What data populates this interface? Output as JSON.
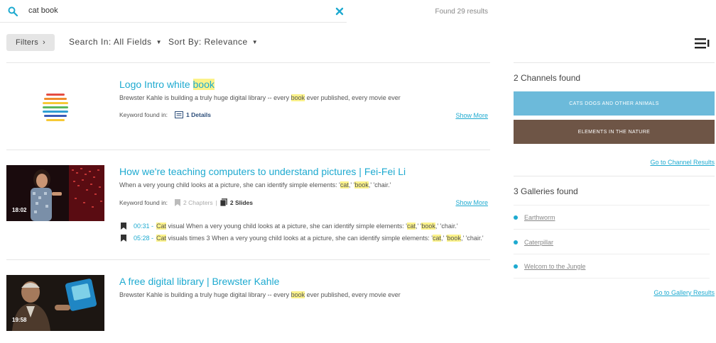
{
  "search": {
    "query": "cat book",
    "found": "Found 29 results"
  },
  "toolbar": {
    "filters": "Filters",
    "search_in": "Search In: All Fields",
    "sort_by": "Sort By: Relevance"
  },
  "results": [
    {
      "title_pre": "Logo Intro white ",
      "title_hl": "book",
      "desc_pre": "Brewster Kahle is building a truly huge digital library -- every ",
      "desc_hl": "book",
      "desc_post": " ever published, every movie ever",
      "keyword_label": "Keyword found in:",
      "details": "1 Details",
      "show_more": "Show More"
    },
    {
      "title": "How we're teaching computers to understand pictures | Fei-Fei Li",
      "desc_pre": "When a very young child looks at a picture, she can identify simple elements: '",
      "desc_hl1": "cat",
      "desc_mid": ",' '",
      "desc_hl2": "book",
      "desc_post": ",' 'chair.'",
      "duration": "18:02",
      "keyword_label": "Keyword found in:",
      "chapters": "2 Chapters",
      "slides": "2 Slides",
      "show_more": "Show More",
      "moments": [
        {
          "time": "00:31 -",
          "hl": "Cat",
          "text_pre": " visual When a very young child looks at a picture, she can identify simple elements: '",
          "hl2": "cat",
          "mid": ",' '",
          "hl3": "book",
          "post": ",' 'chair.'"
        },
        {
          "time": "05:28 -",
          "hl": "Cat",
          "text_pre": " visuals times 3 When a very young child looks at a picture, she can identify simple elements: '",
          "hl2": "cat",
          "mid": ",' '",
          "hl3": "book",
          "post": ",' 'chair.'"
        }
      ]
    },
    {
      "title": "A free digital library | Brewster Kahle",
      "desc_pre": "Brewster Kahle is building a truly huge digital library -- every ",
      "desc_hl": "book",
      "desc_post": " ever published, every movie ever",
      "duration": "19:58"
    }
  ],
  "channels": {
    "heading": "2 Channels found",
    "items": [
      {
        "label": "CATS DOGS AND OTHER ANIMALS",
        "color": "#6cbada"
      },
      {
        "label": "ELEMENTS IN THE NATURE",
        "color": "#6e5546"
      }
    ],
    "link": "Go to Channel Results"
  },
  "galleries": {
    "heading": "3 Galleries found",
    "items": [
      "Earthworm",
      "Caterpillar",
      "Welcom to the Jungle"
    ],
    "link": "Go to Gallery Results"
  },
  "colors": {
    "accent": "#1eaad0",
    "highlight": "#fbf28a"
  }
}
